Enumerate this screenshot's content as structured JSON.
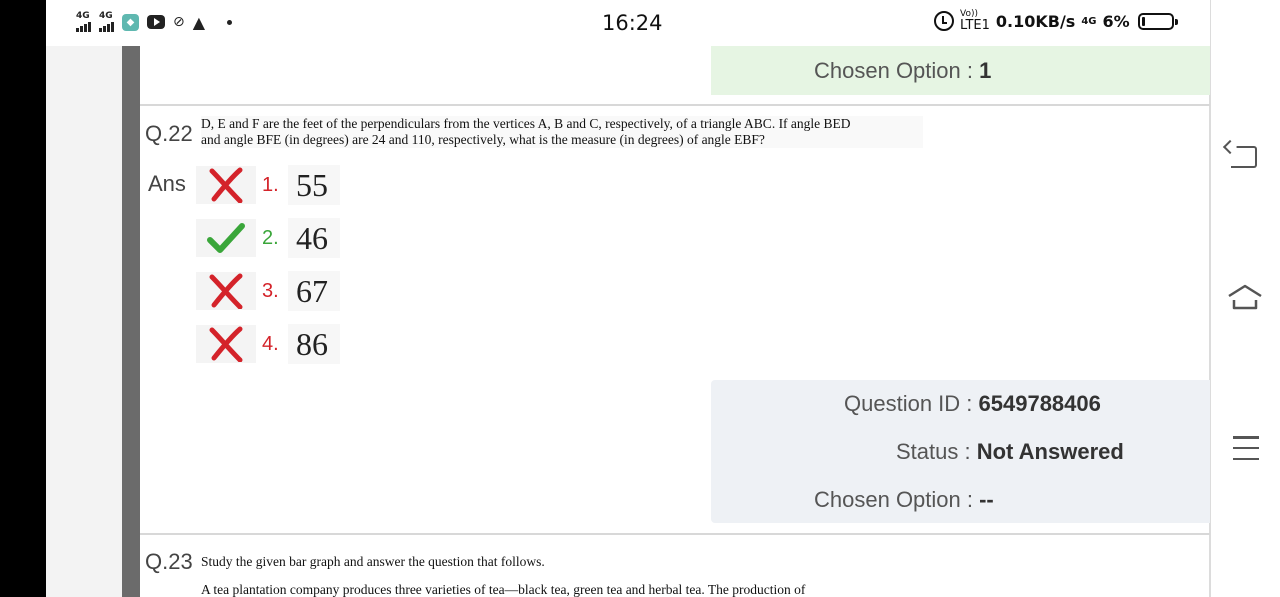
{
  "status_bar": {
    "signal1_label": "4G",
    "signal2_label": "4G",
    "time": "16:24",
    "volte_top": "Vo))",
    "volte_bottom": "LTE1",
    "net_speed": "0.10KB/s",
    "net_type": "4G",
    "battery_pct": "6%",
    "icons": [
      "signal-icon",
      "signal-icon",
      "app-icon",
      "youtube-icon",
      "no-data-icon",
      "warning-icon",
      "dot-icon",
      "alarm-icon",
      "volte-icon",
      "battery-icon"
    ]
  },
  "prev_question": {
    "chosen_option_label": "Chosen Option :",
    "chosen_option_value": "1"
  },
  "question_22": {
    "number": "Q.22",
    "text_line1": "D, E and F are the feet of the perpendiculars from the vertices A, B and C, respectively, of a triangle ABC. If angle BED",
    "text_line2": "and angle BFE (in degrees) are 24 and 110, respectively, what is the measure (in degrees) of angle EBF?",
    "ans_label": "Ans",
    "options": [
      {
        "num": "1.",
        "value": "55",
        "correct": false
      },
      {
        "num": "2.",
        "value": "46",
        "correct": true
      },
      {
        "num": "3.",
        "value": "67",
        "correct": false
      },
      {
        "num": "4.",
        "value": "86",
        "correct": false
      }
    ],
    "info": {
      "question_id_label": "Question ID :",
      "question_id_value": "6549788406",
      "status_label": "Status :",
      "status_value": "Not Answered",
      "chosen_option_label": "Chosen Option :",
      "chosen_option_value": "--"
    }
  },
  "question_23": {
    "number": "Q.23",
    "text_line1": "Study the given bar graph and answer the question that follows.",
    "text_line2": "A tea plantation company produces three varieties of tea—black tea, green tea and herbal tea. The production of"
  },
  "colors": {
    "correct": "#3aa63a",
    "wrong": "#d4232a",
    "chosen_panel_bg": "#e6f5e3",
    "info_panel_bg": "#eef1f5"
  }
}
